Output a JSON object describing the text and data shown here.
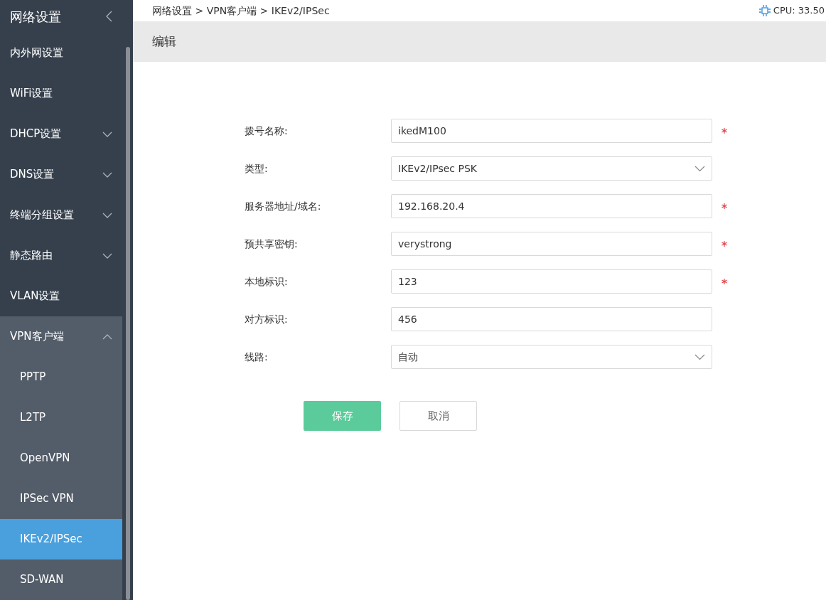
{
  "sidebar": {
    "title": "网络设置",
    "items": [
      {
        "label": "内外网设置",
        "selected": false
      },
      {
        "label": "WiFi设置",
        "selected": false
      },
      {
        "label": "DHCP设置",
        "expanded": false,
        "selected": false
      },
      {
        "label": "DNS设置",
        "expanded": false,
        "selected": false
      },
      {
        "label": "终端分组设置",
        "expanded": false,
        "selected": false
      },
      {
        "label": "静态路由",
        "expanded": false,
        "selected": false
      },
      {
        "label": "VLAN设置",
        "selected": false
      },
      {
        "label": "VPN客户端",
        "expanded": true,
        "selected": false,
        "children": [
          {
            "label": "PPTP",
            "selected": false
          },
          {
            "label": "L2TP",
            "selected": false
          },
          {
            "label": "OpenVPN",
            "selected": false
          },
          {
            "label": "IPSec VPN",
            "selected": false
          },
          {
            "label": "IKEv2/IPSec",
            "selected": true
          },
          {
            "label": "SD-WAN",
            "selected": false
          }
        ]
      }
    ]
  },
  "breadcrumb": "网络设置 > VPN客户端 > IKEv2/IPSec",
  "cpu": "CPU: 33.50",
  "panel_title": "编辑",
  "form": [
    {
      "label": "拨号名称:",
      "kind": "text",
      "value": "ikedM100",
      "required": true
    },
    {
      "label": "类型:",
      "kind": "select",
      "value": "IKEv2/IPsec PSK",
      "required": false
    },
    {
      "label": "服务器地址/域名:",
      "kind": "text",
      "value": "192.168.20.4",
      "required": true
    },
    {
      "label": "预共享密钥:",
      "kind": "text",
      "value": "verystrong",
      "required": true
    },
    {
      "label": "本地标识:",
      "kind": "text",
      "value": "123",
      "required": true
    },
    {
      "label": "对方标识:",
      "kind": "text",
      "value": "456",
      "required": false
    },
    {
      "label": "线路:",
      "kind": "select",
      "value": "自动",
      "required": false
    }
  ],
  "buttons": [
    {
      "label": "保存",
      "kind": "primary"
    },
    {
      "label": "取消",
      "kind": "secondary"
    }
  ]
}
